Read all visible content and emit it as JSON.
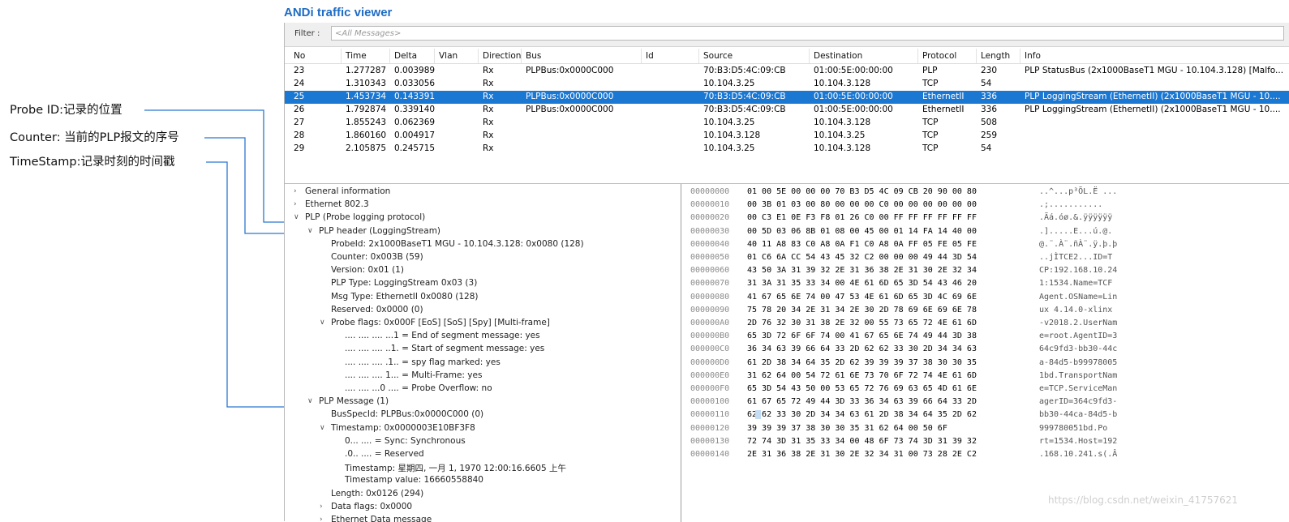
{
  "annotations": [
    "Probe ID:记录的位置",
    "Counter: 当前的PLP报文的序号",
    "TimeStamp:记录时刻的时间戳"
  ],
  "app": {
    "title": "ANDi traffic viewer",
    "filter_label": "Filter :",
    "filter_placeholder": "<All Messages>"
  },
  "columns": [
    "No",
    "Time",
    "Delta",
    "Vlan",
    "Direction",
    "Bus",
    "Id",
    "Source",
    "Destination",
    "Protocol",
    "Length",
    "Info"
  ],
  "rows": [
    {
      "no": "23",
      "time": "1.277287",
      "delta": "0.003989",
      "vlan": "",
      "dir": "Rx",
      "bus": "PLPBus:0x0000C000",
      "id": "",
      "src": "70:B3:D5:4C:09:CB",
      "dst": "01:00:5E:00:00:00",
      "proto": "PLP",
      "len": "230",
      "info": "PLP StatusBus (2x1000BaseT1 MGU - 10.104.3.128) [Malfo..."
    },
    {
      "no": "24",
      "time": "1.310343",
      "delta": "0.033056",
      "vlan": "",
      "dir": "Rx",
      "bus": "",
      "id": "",
      "src": "10.104.3.25",
      "dst": "10.104.3.128",
      "proto": "TCP",
      "len": "54",
      "info": ""
    },
    {
      "no": "25",
      "time": "1.453734",
      "delta": "0.143391",
      "vlan": "",
      "dir": "Rx",
      "bus": "PLPBus:0x0000C000",
      "id": "",
      "src": "70:B3:D5:4C:09:CB",
      "dst": "01:00:5E:00:00:00",
      "proto": "EthernetII",
      "len": "336",
      "info": "PLP LoggingStream (EthernetII) (2x1000BaseT1 MGU - 10...."
    },
    {
      "no": "26",
      "time": "1.792874",
      "delta": "0.339140",
      "vlan": "",
      "dir": "Rx",
      "bus": "PLPBus:0x0000C000",
      "id": "",
      "src": "70:B3:D5:4C:09:CB",
      "dst": "01:00:5E:00:00:00",
      "proto": "EthernetII",
      "len": "336",
      "info": "PLP LoggingStream (EthernetII) (2x1000BaseT1 MGU - 10...."
    },
    {
      "no": "27",
      "time": "1.855243",
      "delta": "0.062369",
      "vlan": "",
      "dir": "Rx",
      "bus": "",
      "id": "",
      "src": "10.104.3.25",
      "dst": "10.104.3.128",
      "proto": "TCP",
      "len": "508",
      "info": ""
    },
    {
      "no": "28",
      "time": "1.860160",
      "delta": "0.004917",
      "vlan": "",
      "dir": "Rx",
      "bus": "",
      "id": "",
      "src": "10.104.3.128",
      "dst": "10.104.3.25",
      "proto": "TCP",
      "len": "259",
      "info": ""
    },
    {
      "no": "29",
      "time": "2.105875",
      "delta": "0.245715",
      "vlan": "",
      "dir": "Rx",
      "bus": "",
      "id": "",
      "src": "10.104.3.25",
      "dst": "10.104.3.128",
      "proto": "TCP",
      "len": "54",
      "info": ""
    }
  ],
  "selected_row": "25",
  "tree": [
    {
      "text": "General information",
      "toggle": ">"
    },
    {
      "text": "Ethernet 802.3",
      "toggle": ">"
    },
    {
      "text": "PLP (Probe logging protocol)",
      "toggle": "v"
    },
    {
      "text": "PLP header (LoggingStream)",
      "toggle": "v"
    },
    {
      "text": "ProbeId: 2x1000BaseT1 MGU - 10.104.3.128: 0x0080 (128)",
      "toggle": ""
    },
    {
      "text": "Counter: 0x003B (59)",
      "toggle": ""
    },
    {
      "text": "Version: 0x01 (1)",
      "toggle": ""
    },
    {
      "text": "PLP Type: LoggingStream 0x03 (3)",
      "toggle": ""
    },
    {
      "text": "Msg Type: EthernetII 0x0080 (128)",
      "toggle": ""
    },
    {
      "text": "Reserved: 0x0000 (0)",
      "toggle": ""
    },
    {
      "text": "Probe flags: 0x000F [EoS] [SoS] [Spy] [Multi-frame]",
      "toggle": "v"
    },
    {
      "text": ".... .... .... ...1 = End of segment message: yes",
      "toggle": ""
    },
    {
      "text": ".... .... .... ..1. = Start of segment message: yes",
      "toggle": ""
    },
    {
      "text": ".... .... .... .1.. = spy flag marked: yes",
      "toggle": ""
    },
    {
      "text": ".... .... .... 1... = Multi-Frame: yes",
      "toggle": ""
    },
    {
      "text": ".... .... ...0 .... = Probe Overflow: no",
      "toggle": ""
    },
    {
      "text": "PLP Message (1)",
      "toggle": "v"
    },
    {
      "text": "BusSpecId: PLPBus:0x0000C000 (0)",
      "toggle": ""
    },
    {
      "text": "Timestamp: 0x0000003E10BF3F8",
      "toggle": "v"
    },
    {
      "text": "0... .... = Sync: Synchronous",
      "toggle": ""
    },
    {
      "text": ".0.. .... = Reserved",
      "toggle": ""
    },
    {
      "text": "Timestamp: 星期四, 一月 1, 1970 12:00:16.6605 上午",
      "toggle": ""
    },
    {
      "text": "Timestamp value: 16660558840",
      "toggle": ""
    },
    {
      "text": "Length: 0x0126 (294)",
      "toggle": ""
    },
    {
      "text": "Data flags: 0x0000",
      "toggle": ">"
    },
    {
      "text": "Ethernet Data message",
      "toggle": ">"
    }
  ],
  "hex": [
    {
      "off": "00000000",
      "bytes": "01 00 5E 00 00 00 70 B3 D5 4C 09 CB 20 90 00 80",
      "ascii": "..^...p³ÕL.Ë ..."
    },
    {
      "off": "00000010",
      "bytes": "00 3B 01 03 00 80 00 00 00 C0 00 00 00 00 00 00",
      "ascii": ".;..........."
    },
    {
      "off": "00000020",
      "bytes": "00 C3 E1 0E F3 F8 01 26 C0 00 FF FF FF FF FF FF",
      "ascii": ".Ãá.óø.&.ÿÿÿÿÿÿ"
    },
    {
      "off": "00000030",
      "bytes": "00 5D 03 06 8B 01 08 00 45 00 01 14 FA 14 40 00",
      "ascii": ".].....E...ú.@."
    },
    {
      "off": "00000040",
      "bytes": "40 11 A8 83 C0 A8 0A F1 C0 A8 0A FF 05 FE 05 FE",
      "ascii": "@.¨.À¨.ñÀ¨.ÿ.þ.þ"
    },
    {
      "off": "00000050",
      "bytes": "01 C6 6A CC 54 43 45 32 C2 00 00 00 49 44 3D 54",
      "ascii": "..jÌTCE2...ID=T"
    },
    {
      "off": "00000060",
      "bytes": "43 50 3A 31 39 32 2E 31 36 38 2E 31 30 2E 32 34",
      "ascii": "CP:192.168.10.24"
    },
    {
      "off": "00000070",
      "bytes": "31 3A 31 35 33 34 00 4E 61 6D 65 3D 54 43 46 20",
      "ascii": "1:1534.Name=TCF"
    },
    {
      "off": "00000080",
      "bytes": "41 67 65 6E 74 00 47 53 4E 61 6D 65 3D 4C 69 6E",
      "ascii": "Agent.OSName=Lin"
    },
    {
      "off": "00000090",
      "bytes": "75 78 20 34 2E 31 34 2E 30 2D 78 69 6E 69 6E 78",
      "ascii": "ux 4.14.0-xlinx"
    },
    {
      "off": "000000A0",
      "bytes": "2D 76 32 30 31 38 2E 32 00 55 73 65 72 4E 61 6D",
      "ascii": "-v2018.2.UserNam"
    },
    {
      "off": "000000B0",
      "bytes": "65 3D 72 6F 6F 74 00 41 67 65 6E 74 49 44 3D 38",
      "ascii": "e=root.AgentID=3"
    },
    {
      "off": "000000C0",
      "bytes": "36 34 63 39 66 64 33 2D 62 62 33 30 2D 34 34 63",
      "ascii": "64c9fd3-bb30-44c"
    },
    {
      "off": "000000D0",
      "bytes": "61 2D 38 34 64 35 2D 62 39 39 39 37 38 30 30 35",
      "ascii": "a-84d5-b99978005"
    },
    {
      "off": "000000E0",
      "bytes": "31 62 64 00 54 72 61 6E 73 70 6F 72 74 4E 61 6D",
      "ascii": "1bd.TransportNam"
    },
    {
      "off": "000000F0",
      "bytes": "65 3D 54 43 50 00 53 65 72 76 69 63 65 4D 61 6E",
      "ascii": "e=TCP.ServiceMan"
    },
    {
      "off": "00000100",
      "bytes": "61 67 65 72 49 44 3D 33 36 34 63 39 66 64 33 2D",
      "ascii": "agerID=364c9fd3-"
    },
    {
      "off": "00000110",
      "bytes": "62 62 33 30 2D 34 34 63 61 2D 38 34 64 35 2D 62",
      "ascii": "bb30-44ca-84d5-b"
    },
    {
      "off": "00000120",
      "bytes": "39 39 39 37 38 30 30 35 31 62 64 00 50 6F",
      "ascii": "999780051bd.Po"
    },
    {
      "off": "00000130",
      "bytes": "72 74 3D 31 35 33 34 00 48 6F 73 74 3D 31 39 32",
      "ascii": "rt=1534.Host=192"
    },
    {
      "off": "00000140",
      "bytes": "2E 31 36 38 2E 31 30 2E 32 34 31 00 73 28 2E C2",
      "ascii": ".168.10.241.s(.Â"
    }
  ],
  "watermark": "https://blog.csdn.net/weixin_41757621",
  "colors": {
    "title": "#1e6cc4",
    "selected_row": "#1a77d2",
    "arrow": "#2a78d0"
  }
}
